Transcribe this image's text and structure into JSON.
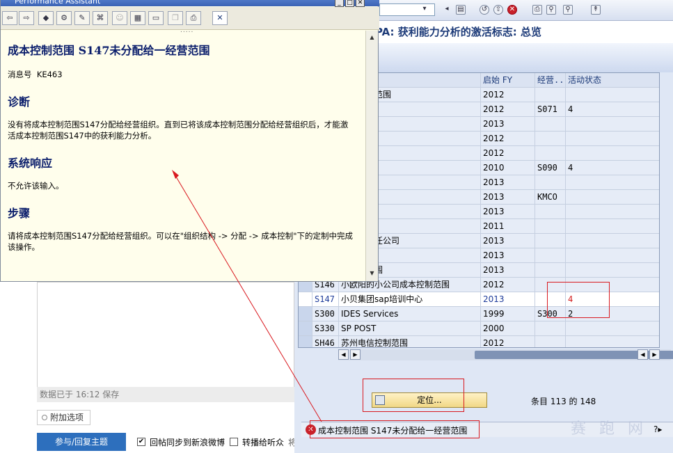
{
  "performance_assistant": {
    "window_title": "Performance Assistant",
    "heading": "成本控制范围 S147未分配给一经营范围",
    "message_no_label": "消息号",
    "message_no": "KE463",
    "section_diagnosis": "诊断",
    "diagnosis_text": "没有将成本控制范围S147分配给经营组织。直到已将该成本控制范围分配给经营组织后，才能激活成本控制范围S147中的获利能力分析。",
    "section_system_response": "系统响应",
    "system_response_text": "不允许该输入。",
    "section_steps": "步骤",
    "steps_text": "请将成本控制范围S147分配给经营组织。可以在\"组织结构 -> 分配 -> 成本控制\"下的定制中完成该操作。",
    "grip": "....."
  },
  "sap": {
    "title": "PA: 获利能力分析的激活标志: 总览",
    "columns": [
      "启始 FY",
      "经营...",
      "活动状态"
    ],
    "rows": [
      {
        "key": "",
        "name": "公司控制范围",
        "fy": "2012",
        "org": "",
        "status": ""
      },
      {
        "key": "",
        "name": "控制范围",
        "fy": "2012",
        "org": "S071",
        "status": "4"
      },
      {
        "key": "",
        "name": "制范围",
        "fy": "2013",
        "org": "",
        "status": ""
      },
      {
        "key": "",
        "name": "范围",
        "fy": "2012",
        "org": "",
        "status": ""
      },
      {
        "key": "",
        "name": "围",
        "fy": "2012",
        "org": "",
        "status": ""
      },
      {
        "key": "",
        "name": "",
        "fy": "2010",
        "org": "S090",
        "status": "4"
      },
      {
        "key": "",
        "name": "",
        "fy": "2013",
        "org": "",
        "status": ""
      },
      {
        "key": "",
        "name": "的公司",
        "fy": "2013",
        "org": "KMCO",
        "status": ""
      },
      {
        "key": "",
        "name": "公司",
        "fy": "2013",
        "org": "",
        "status": ""
      },
      {
        "key": "",
        "name": "控制范围",
        "fy": "2011",
        "org": "",
        "status": ""
      },
      {
        "key": "",
        "name": "口有限责任公司",
        "fy": "2013",
        "org": "",
        "status": ""
      },
      {
        "key": "",
        "name": "控制范围",
        "fy": "2013",
        "org": "",
        "status": ""
      },
      {
        "key": "",
        "name": "络控制范围",
        "fy": "2013",
        "org": "",
        "status": ""
      },
      {
        "key": "S146",
        "name": "小欧阳的小公司成本控制范围",
        "fy": "2012",
        "org": "",
        "status": ""
      },
      {
        "key": "S147",
        "name": "小贝集团sap培训中心",
        "fy": "2013",
        "org": "",
        "status": "4"
      },
      {
        "key": "S300",
        "name": "IDES Services",
        "fy": "1999",
        "org": "S300",
        "status": "2"
      },
      {
        "key": "S330",
        "name": "SP POST",
        "fy": "2000",
        "org": "",
        "status": ""
      },
      {
        "key": "SH46",
        "name": "苏州电信控制范围",
        "fy": "2012",
        "org": "",
        "status": ""
      }
    ],
    "position_button": "定位...",
    "entries_text": "条目 113 的 148",
    "status_message": "成本控制范围 S147未分配给一经营范围"
  },
  "forum": {
    "saved_text": "数据已于 16:12 保存",
    "attach_label": "附加选项",
    "reply_button": "参与/回复主题",
    "sync_weibo_label": "回帖同步到新浪微博",
    "sync_weibo_checked": true,
    "broadcast_label": "转播给听众",
    "cut_text": "将此主题同步到"
  },
  "watermark": "赛 跑 网"
}
